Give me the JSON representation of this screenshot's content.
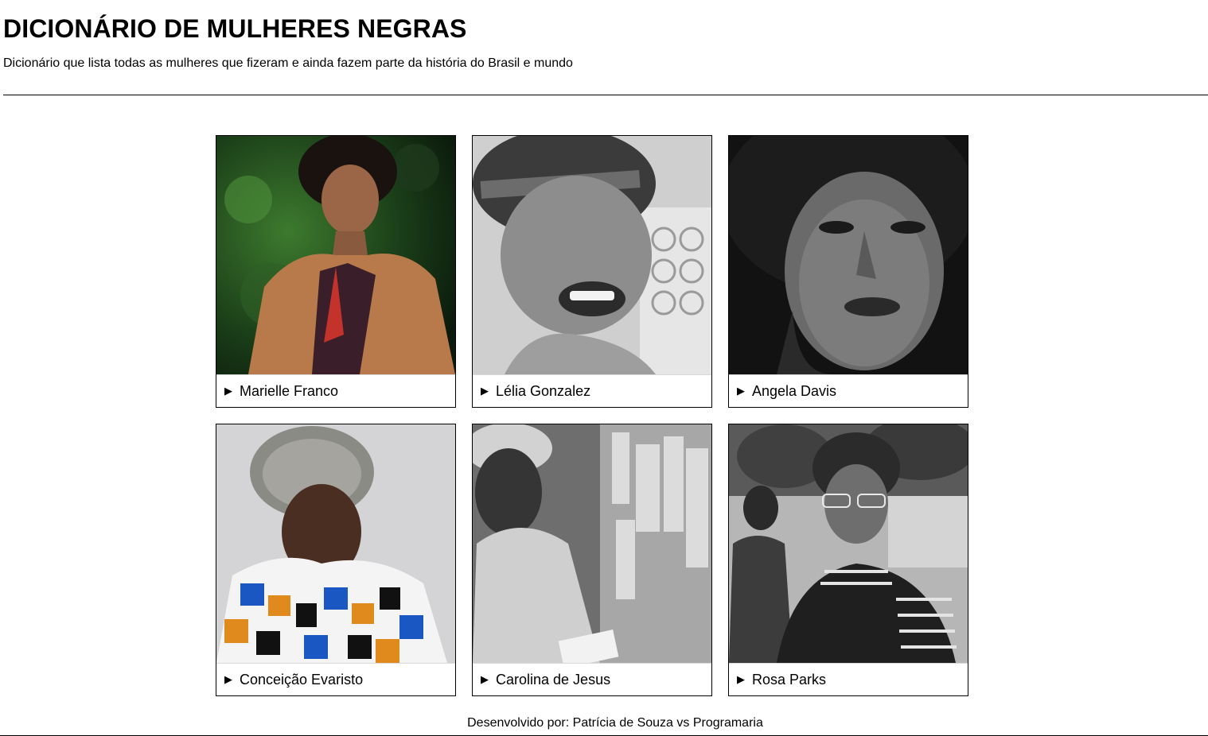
{
  "header": {
    "title": "DICIONÁRIO DE MULHERES NEGRAS",
    "subtitle": "Dicionário que lista todas as mulheres que fizeram e ainda fazem parte da história do Brasil e mundo"
  },
  "cards": [
    {
      "name": "Marielle Franco",
      "photo": "portrait-photo-color"
    },
    {
      "name": "Lélia Gonzalez",
      "photo": "portrait-photo-bw"
    },
    {
      "name": "Angela Davis",
      "photo": "portrait-photo-bw"
    },
    {
      "name": "Conceição Evaristo",
      "photo": "portrait-photo-color"
    },
    {
      "name": "Carolina de Jesus",
      "photo": "portrait-photo-bw"
    },
    {
      "name": "Rosa Parks",
      "photo": "portrait-photo-bw"
    }
  ],
  "disclosure_icon": "disclosure-triangle-icon",
  "footer": {
    "text": "Desenvolvido por: Patrícia de Souza vs Programaria"
  }
}
